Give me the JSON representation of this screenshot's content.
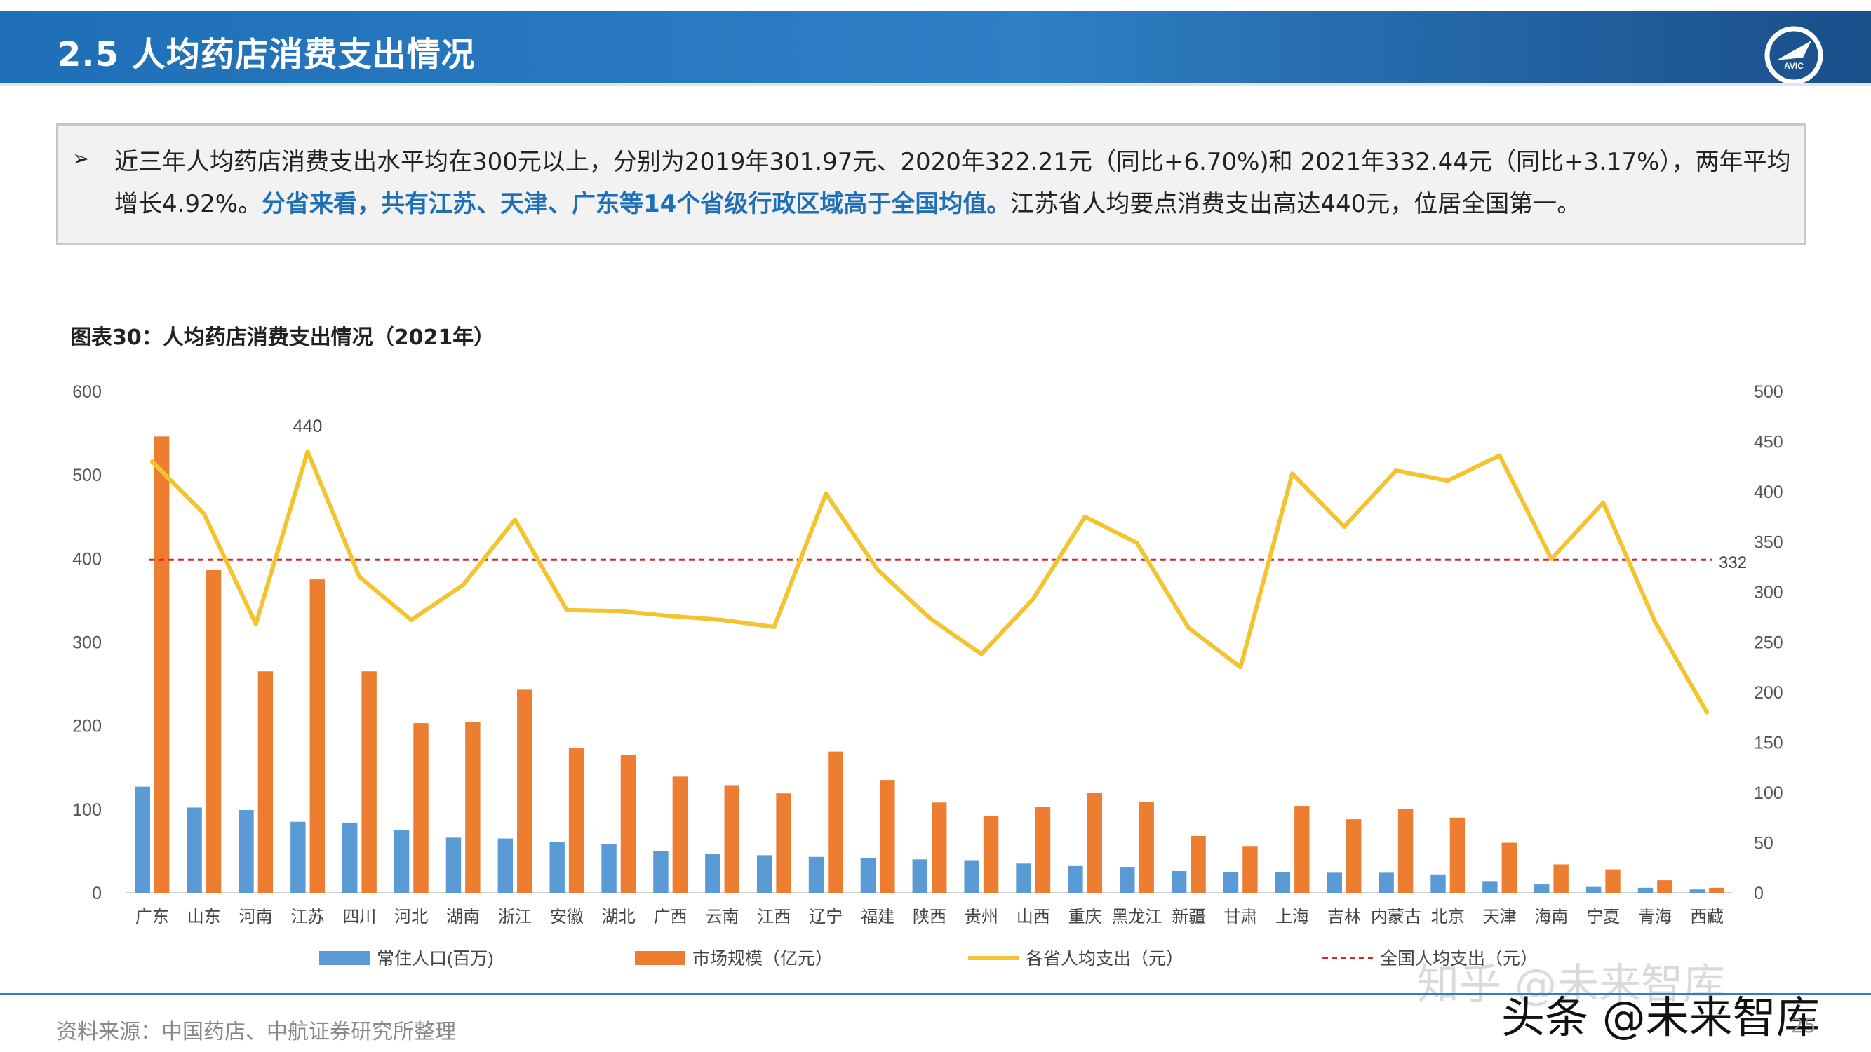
{
  "header": {
    "title": "2.5 人均药店消费支出情况",
    "logo_text": "AVIC"
  },
  "summary": {
    "bullet": "➢",
    "text_part1": "近三年人均药店消费支出水平均在300元以上，分别为2019年301.97元、2020年322.21元（同比+6.70%)和 2021年332.44元（同比+3.17%），两年平均增长4.92%。",
    "text_highlight": "分省来看，共有江苏、天津、广东等14个省级行政区域高于全国均值。",
    "text_part2": "江苏省人均要点消费支出高达440元，位居全国第一。"
  },
  "chart_title": "图表30：人均药店消费支出情况（2021年）",
  "chart_data": {
    "type": "bar",
    "categories": [
      "广东",
      "山东",
      "河南",
      "江苏",
      "四川",
      "河北",
      "湖南",
      "浙江",
      "安徽",
      "湖北",
      "广西",
      "云南",
      "江西",
      "辽宁",
      "福建",
      "陕西",
      "贵州",
      "山西",
      "重庆",
      "黑龙江",
      "新疆",
      "甘肃",
      "上海",
      "吉林",
      "内蒙古",
      "北京",
      "天津",
      "海南",
      "宁夏",
      "青海",
      "西藏"
    ],
    "series": [
      {
        "name": "常住人口(百万)",
        "axis": "left",
        "type": "bar",
        "color": "#5b9bd5",
        "values": [
          127,
          102,
          99,
          85,
          84,
          75,
          66,
          65,
          61,
          58,
          50,
          47,
          45,
          43,
          42,
          40,
          39,
          35,
          32,
          31,
          26,
          25,
          25,
          24,
          24,
          22,
          14,
          10,
          7,
          6,
          4
        ]
      },
      {
        "name": "市场规模（亿元）",
        "axis": "left",
        "type": "bar",
        "color": "#ed7d31",
        "values": [
          546,
          386,
          265,
          375,
          265,
          203,
          204,
          243,
          173,
          165,
          139,
          128,
          119,
          169,
          135,
          108,
          92,
          103,
          120,
          109,
          68,
          56,
          104,
          88,
          100,
          90,
          60,
          34,
          28,
          15,
          6
        ]
      },
      {
        "name": "各省人均支出（元）",
        "axis": "right",
        "type": "line",
        "color": "#f4c430",
        "values": [
          430,
          378,
          268,
          440,
          315,
          272,
          307,
          372,
          282,
          281,
          276,
          272,
          265,
          398,
          322,
          274,
          238,
          293,
          375,
          349,
          264,
          225,
          418,
          365,
          421,
          411,
          436,
          333,
          389,
          270,
          180
        ]
      },
      {
        "name": "全国人均支出（元）",
        "axis": "right",
        "type": "reference_line",
        "color": "#d62728",
        "value": 332
      }
    ],
    "ylim_left": [
      0,
      600
    ],
    "yticks_left": [
      0,
      100,
      200,
      300,
      400,
      500,
      600
    ],
    "ylim_right": [
      0,
      500
    ],
    "yticks_right": [
      0,
      50,
      100,
      150,
      200,
      250,
      300,
      350,
      400,
      450,
      500
    ],
    "annotations": [
      "440",
      "332"
    ],
    "legend_position": "bottom",
    "grid": false
  },
  "footer": {
    "source": "资料来源：中国药店、中航证券研究所整理",
    "page": "25"
  },
  "watermark": {
    "line1": "知乎 @未来智库",
    "line2": "头条 @未来智库"
  }
}
